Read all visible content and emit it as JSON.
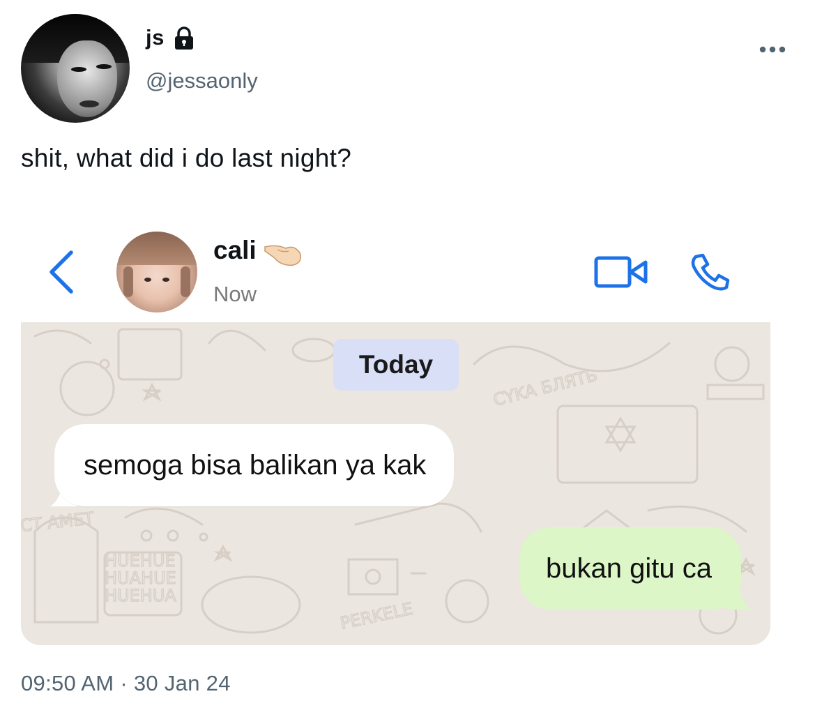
{
  "tweet": {
    "display_name": "js",
    "handle": "@jessaonly",
    "text": "shit, what did i do last night?",
    "time": "09:50 AM",
    "separator": "·",
    "date": "30 Jan 24",
    "icons": {
      "lock": "lock-icon",
      "more": "more-horizontal-icon"
    }
  },
  "chat": {
    "contact_name": "cali",
    "status": "Now",
    "date_divider": "Today",
    "icons": {
      "back": "chevron-left-icon",
      "video": "video-call-icon",
      "phone": "phone-call-icon",
      "emoji": "pinching-hand-emoji"
    },
    "messages": [
      {
        "direction": "incoming",
        "text": "semoga bisa balikan ya kak"
      },
      {
        "direction": "outgoing",
        "text": "bukan gitu ca"
      }
    ],
    "wallpaper_words": [
      "CYKA БЛЯТЬ",
      "PERKELE",
      "HUEHUE",
      "HUAHUE",
      "HUEHUA",
      "CT AMET"
    ],
    "colors": {
      "accent": "#1d72e8",
      "incoming_bubble": "#ffffff",
      "outgoing_bubble": "#dcf6c8",
      "date_chip": "#d9dff7",
      "wallpaper": "#ebe6e0"
    }
  }
}
